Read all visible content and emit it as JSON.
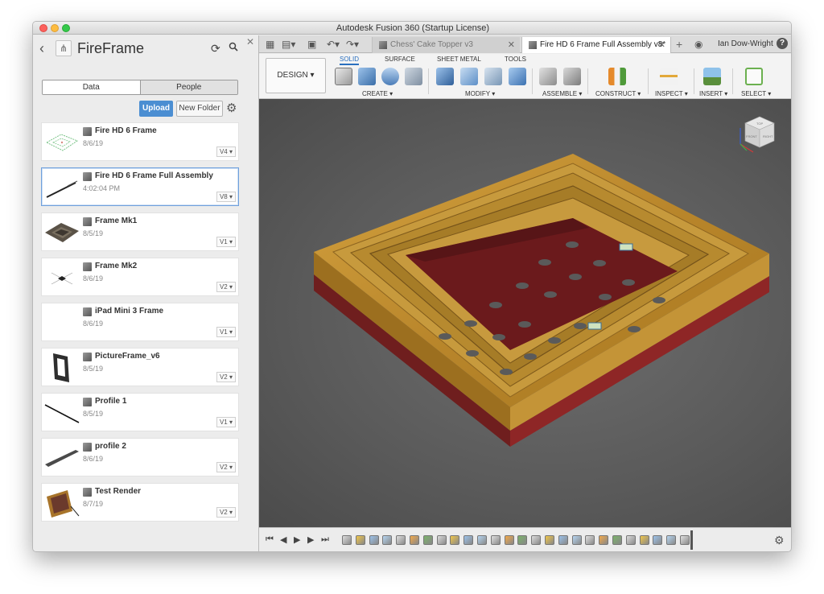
{
  "window": {
    "title": "Autodesk Fusion 360 (Startup License)"
  },
  "panel": {
    "project_title": "FireFrame",
    "tabs": {
      "data": "Data",
      "people": "People"
    },
    "upload_label": "Upload",
    "new_folder_label": "New Folder",
    "files": [
      {
        "name": "Fire HD 6 Frame",
        "date": "8/6/19",
        "version": "V4 ▾"
      },
      {
        "name": "Fire HD 6 Frame Full Assembly",
        "date": "4:02:04 PM",
        "version": "V8 ▾"
      },
      {
        "name": "Frame Mk1",
        "date": "8/5/19",
        "version": "V1 ▾"
      },
      {
        "name": "Frame Mk2",
        "date": "8/6/19",
        "version": "V2 ▾"
      },
      {
        "name": "iPad Mini 3 Frame",
        "date": "8/6/19",
        "version": "V1 ▾"
      },
      {
        "name": "PictureFrame_v6",
        "date": "8/5/19",
        "version": "V2 ▾"
      },
      {
        "name": "Profile 1",
        "date": "8/5/19",
        "version": "V1 ▾"
      },
      {
        "name": "profile 2",
        "date": "8/6/19",
        "version": "V2 ▾"
      },
      {
        "name": "Test Render",
        "date": "8/7/19",
        "version": "V2 ▾"
      }
    ]
  },
  "tabbar": {
    "tabs": [
      {
        "label": "Chess' Cake Topper v3"
      },
      {
        "label": "Fire HD 6 Frame Full Assembly v8*"
      }
    ],
    "user": "Ian Dow-Wright"
  },
  "toolbar": {
    "workspace": "DESIGN ▾",
    "workspace_tabs": [
      "SOLID",
      "SURFACE",
      "SHEET METAL",
      "TOOLS"
    ],
    "groups": [
      "CREATE ▾",
      "MODIFY ▾",
      "ASSEMBLE ▾",
      "CONSTRUCT ▾",
      "INSPECT ▾",
      "INSERT ▾",
      "SELECT ▾"
    ]
  },
  "viewcube": {
    "top": "TOP",
    "front": "FRONT",
    "right": "RIGHT"
  },
  "colors": {
    "accent": "#4b8ed2",
    "frame_wood": "#b7892d",
    "frame_base": "#8a2424",
    "viewport_bg": "#5a5a5a"
  },
  "icons": {
    "back": "chevron-left-icon",
    "refresh": "refresh-icon",
    "search": "search-icon",
    "settings": "gear-icon",
    "help": "help-icon"
  }
}
